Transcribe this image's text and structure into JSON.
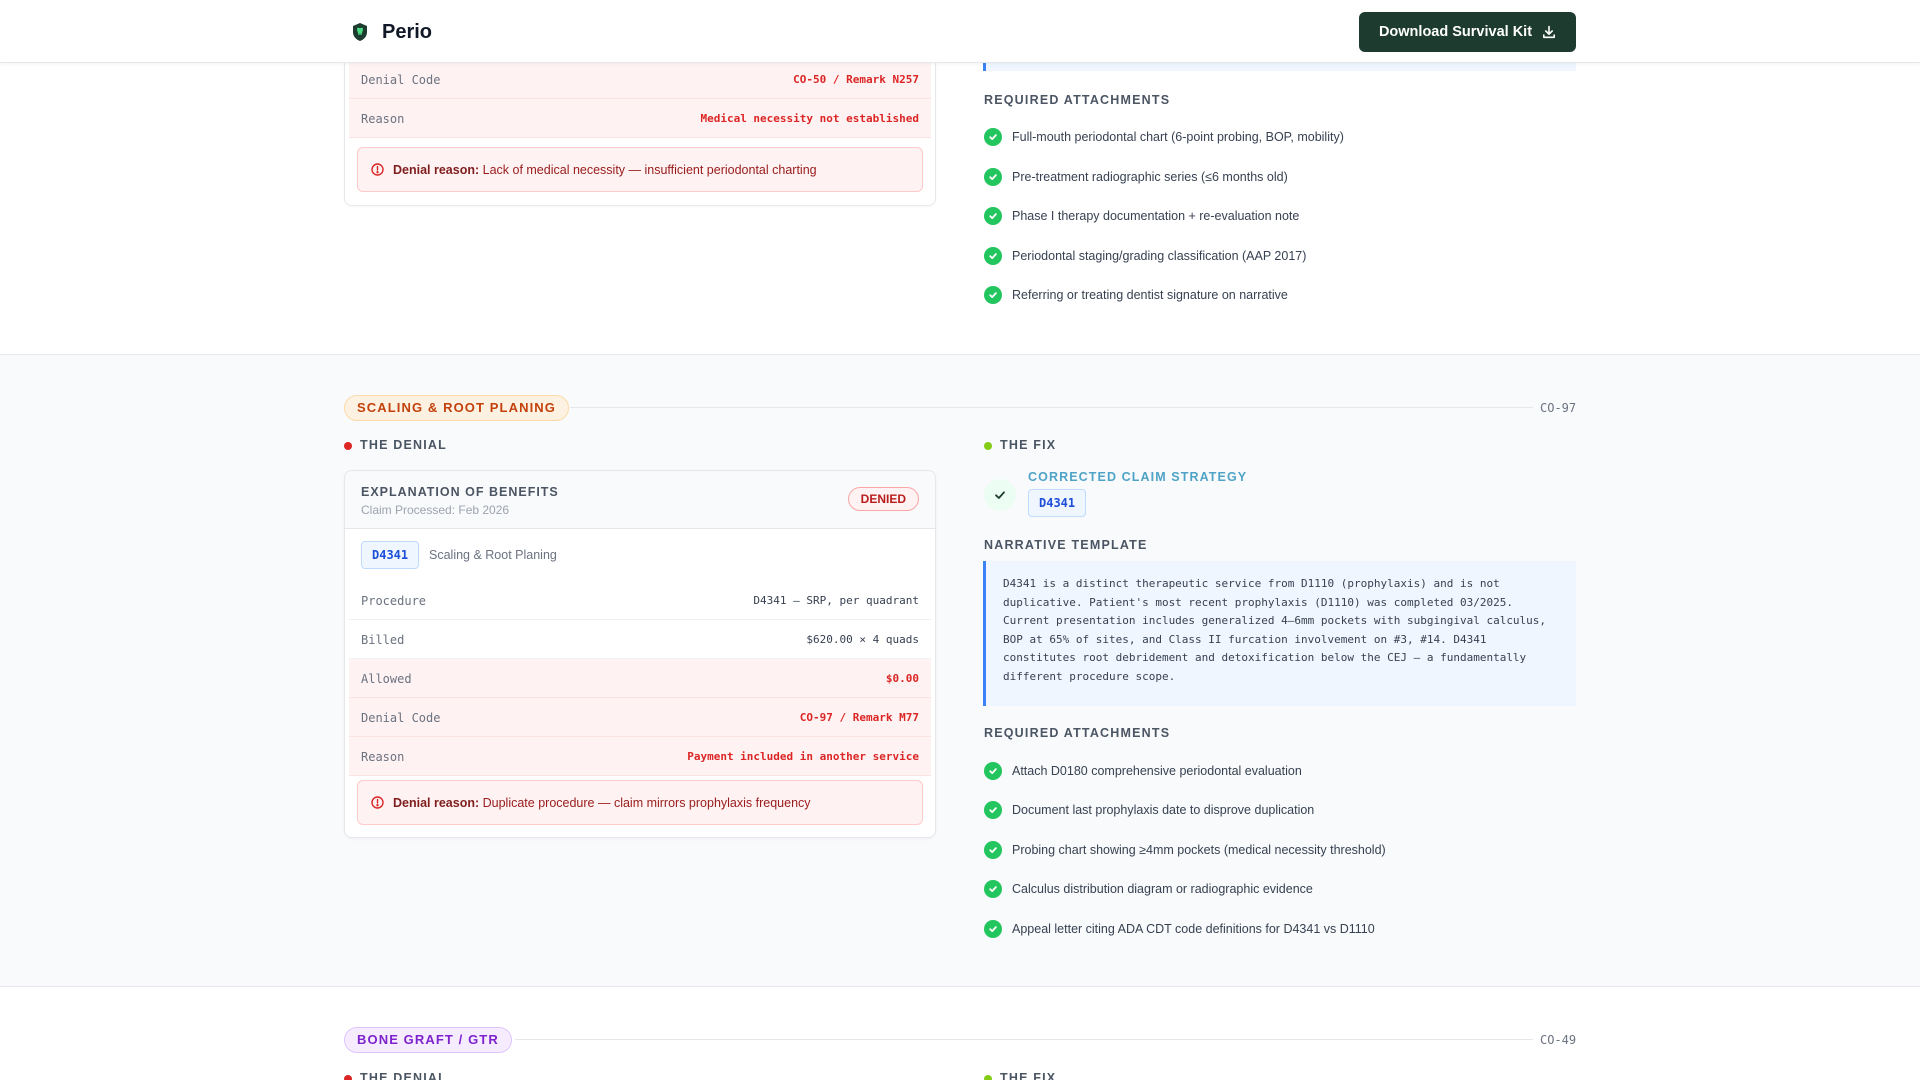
{
  "header": {
    "brand": "Perio",
    "download_label": "Download Survival Kit"
  },
  "top_section": {
    "eob_rows": [
      {
        "key": "Denial Code",
        "value": "CO-50 / Remark N257"
      },
      {
        "key": "Reason",
        "value": "Medical necessity not established"
      }
    ],
    "denial_reason_label": "Denial reason:",
    "denial_reason_text": "Lack of medical necessity — insufficient periodontal charting",
    "required_attachments_label": "REQUIRED ATTACHMENTS",
    "attachments": [
      "Full-mouth periodontal chart (6-point probing, BOP, mobility)",
      "Pre-treatment radiographic series (≤6 months old)",
      "Phase I therapy documentation + re-evaluation note",
      "Periodontal staging/grading classification (AAP 2017)",
      "Referring or treating dentist signature on narrative"
    ]
  },
  "srp_section": {
    "category": "SCALING & ROOT PLANING",
    "code_ref": "CO-97",
    "denial_label": "THE DENIAL",
    "fix_label": "THE FIX",
    "eob": {
      "title": "EXPLANATION OF BENEFITS",
      "subtitle": "Claim Processed: Feb 2026",
      "status": "DENIED",
      "code": "D4341",
      "code_desc": "Scaling & Root Planing",
      "rows": [
        {
          "key": "Procedure",
          "value": "D4341 — SRP, per quadrant"
        },
        {
          "key": "Billed",
          "value": "$620.00 × 4 quads"
        },
        {
          "key": "Allowed",
          "value": "$0.00"
        },
        {
          "key": "Denial Code",
          "value": "CO-97 / Remark M77"
        },
        {
          "key": "Reason",
          "value": "Payment included in another service"
        }
      ],
      "denial_reason_label": "Denial reason:",
      "denial_reason_text": "Duplicate procedure — claim mirrors prophylaxis frequency"
    },
    "fix": {
      "strategy_label": "CORRECTED CLAIM STRATEGY",
      "code": "D4341",
      "narrative_label": "NARRATIVE TEMPLATE",
      "narrative": "D4341 is a distinct therapeutic service from D1110 (prophylaxis) and is not\nduplicative. Patient's most recent prophylaxis (D1110) was completed 03/2025.\nCurrent presentation includes generalized 4–6mm pockets with subgingival calculus,\nBOP at 65% of sites, and Class II furcation involvement on #3, #14. D4341\nconstitutes root debridement and detoxification below the CEJ — a fundamentally\ndifferent procedure scope.",
      "required_attachments_label": "REQUIRED ATTACHMENTS",
      "attachments": [
        "Attach D0180 comprehensive periodontal evaluation",
        "Document last prophylaxis date to disprove duplication",
        "Probing chart showing ≥4mm pockets (medical necessity threshold)",
        "Calculus distribution diagram or radiographic evidence",
        "Appeal letter citing ADA CDT code definitions for D4341 vs D1110"
      ]
    }
  },
  "bone_section": {
    "category": "BONE GRAFT / GTR",
    "code_ref": "CO-49",
    "denial_label": "THE DENIAL",
    "fix_label": "THE FIX"
  },
  "colors": {
    "brand_dark": "#1d3b2f",
    "denied_red": "#dc2626",
    "check_green": "#22c55e",
    "fix_blue": "#3b82f6",
    "srp_pill": "#c2410c",
    "bone_pill": "#7e22ce"
  }
}
